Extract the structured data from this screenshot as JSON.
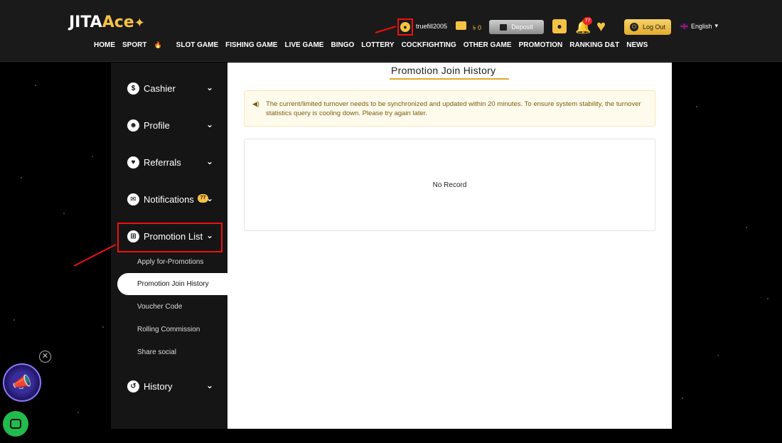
{
  "header": {
    "logo_main": "JITA",
    "logo_accent": "Ace",
    "username": "truefill2005",
    "balance": "৳ 0",
    "deposit_label": "Deposit",
    "notification_count": "77",
    "logout_label": "Log Out",
    "language": "English"
  },
  "nav": {
    "items": [
      "HOME",
      "SPORT",
      "SLOT GAME",
      "FISHING GAME",
      "LIVE GAME",
      "BINGO",
      "LOTTERY",
      "COCKFIGHTING",
      "OTHER GAME",
      "PROMOTION",
      "RANKING D&T",
      "NEWS"
    ]
  },
  "sidebar": {
    "menu": [
      {
        "label": "Cashier",
        "icon": "cashier-icon"
      },
      {
        "label": "Profile",
        "icon": "profile-icon"
      },
      {
        "label": "Referrals",
        "icon": "heart-icon"
      },
      {
        "label": "Notifications",
        "icon": "mail-icon",
        "badge": "77"
      },
      {
        "label": "Promotion List",
        "icon": "gift-icon"
      },
      {
        "label": "History",
        "icon": "history-icon"
      }
    ],
    "promotion_sub": [
      "Apply for-Promotions",
      "Promotion Join History",
      "Voucher Code",
      "Rolling Commission",
      "Share social"
    ],
    "active_sub": "Promotion Join History"
  },
  "main": {
    "title": "Promotion Join History",
    "notice": "The current/limited turnover needs to be synchronized and updated within 20 minutes. To ensure system stability, the turnover statistics query is cooling down. Please try again later.",
    "empty_text": "No Record"
  },
  "colors": {
    "accent": "#f5c243",
    "highlight_box": "#ee1111",
    "notice_bg": "#fffbec"
  }
}
